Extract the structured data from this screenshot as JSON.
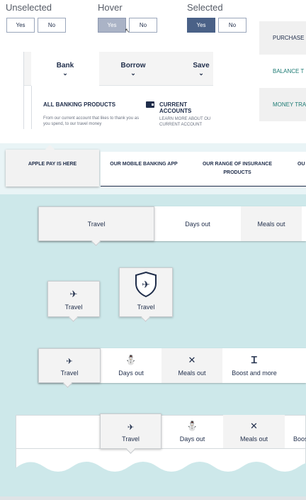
{
  "states": {
    "unselected": {
      "label": "Unselected",
      "yes": "Yes",
      "no": "No"
    },
    "hover": {
      "label": "Hover",
      "yes": "Yes",
      "no": "No"
    },
    "selected": {
      "label": "Selected",
      "yes": "Yes",
      "no": "No"
    }
  },
  "right_list": [
    "PURCHASE",
    "BALANCE T",
    "MONEY TRA"
  ],
  "menu": {
    "tabs": [
      "Bank",
      "Borrow",
      "Save"
    ],
    "heading": "ALL BANKING PRODUCTS",
    "description": "From our current account that likes to thank you as you spend, to our travel money",
    "feature_title": "CURRENT ACCOUNTS",
    "feature_desc": "LEARN MORE ABOUT OU CURRENT ACCOUNT"
  },
  "banner": {
    "items": [
      "APPLE PAY IS HERE",
      "OUR MOBILE BANKING APP",
      "OUR RANGE OF INSURANCE PRODUCTS",
      "OU"
    ]
  },
  "tabs_row1": [
    "Travel",
    "Days out",
    "Meals out"
  ],
  "single_tiles": [
    "Travel",
    "Travel"
  ],
  "tabs_row2": [
    "Travel",
    "Days out",
    "Meals out",
    "Boost and more"
  ],
  "tabs_row3": [
    "Travel",
    "Days out",
    "Meals out",
    "Boos"
  ],
  "icons": {
    "travel": "airplane-icon",
    "days_out": "gift-icon",
    "meals_out": "cutlery-icon",
    "boost": "boost-icon",
    "shield": "shield-icon",
    "chevron": "chevron-down-icon",
    "card": "card-icon"
  },
  "colors": {
    "navy": "#1f2d4a",
    "selected": "#4a6187",
    "hover": "#aab3c6",
    "teal_bg": "#cde8ea",
    "banner_bg": "#e9f4f6",
    "green_text": "#1d7b74"
  }
}
